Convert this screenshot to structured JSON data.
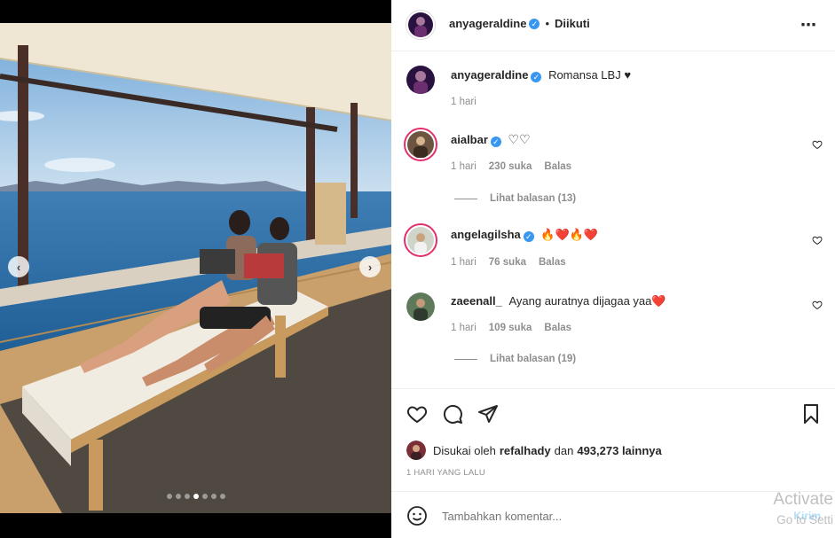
{
  "post": {
    "author": "anyageraldine",
    "follow_status": "Diikuti",
    "caption": "Romansa LBJ ♥",
    "caption_time": "1 hari",
    "carousel": {
      "total": 7,
      "active_index": 3
    }
  },
  "comments": [
    {
      "user": "aialbar",
      "verified": true,
      "text": "♡♡",
      "time": "1 hari",
      "likes": "230 suka",
      "reply": "Balas",
      "view_replies": "Lihat balasan (13)"
    },
    {
      "user": "angelagilsha",
      "verified": true,
      "text": "🔥❤️🔥❤️",
      "time": "1 hari",
      "likes": "76 suka",
      "reply": "Balas",
      "view_replies": ""
    },
    {
      "user": "zaeenall_",
      "verified": false,
      "text": "Ayang auratnya dijagaa yaa❤️",
      "time": "1 hari",
      "likes": "109 suka",
      "reply": "Balas",
      "view_replies": "Lihat balasan (19)"
    }
  ],
  "likes_line": {
    "prefix": "Disukai oleh",
    "user": "refalhady",
    "middle": "dan",
    "count": "493,273 lainnya"
  },
  "post_time": "1 HARI YANG LALU",
  "comment_input": {
    "placeholder": "Tambahkan komentar...",
    "submit": "Kirim"
  },
  "watermark": {
    "line1": "Activate",
    "line2": "Go to Setti"
  },
  "icons": {
    "more": "more-horizontal-icon",
    "like": "heart-icon",
    "comment": "comment-icon",
    "share": "send-icon",
    "save": "bookmark-icon",
    "emoji": "emoji-icon",
    "prev": "chevron-left-icon",
    "next": "chevron-right-icon"
  },
  "colors": {
    "verified": "#3897f0",
    "text": "#262626",
    "muted": "#8e8e8e",
    "story_ring": "#e1306c",
    "link": "#0095f6"
  }
}
